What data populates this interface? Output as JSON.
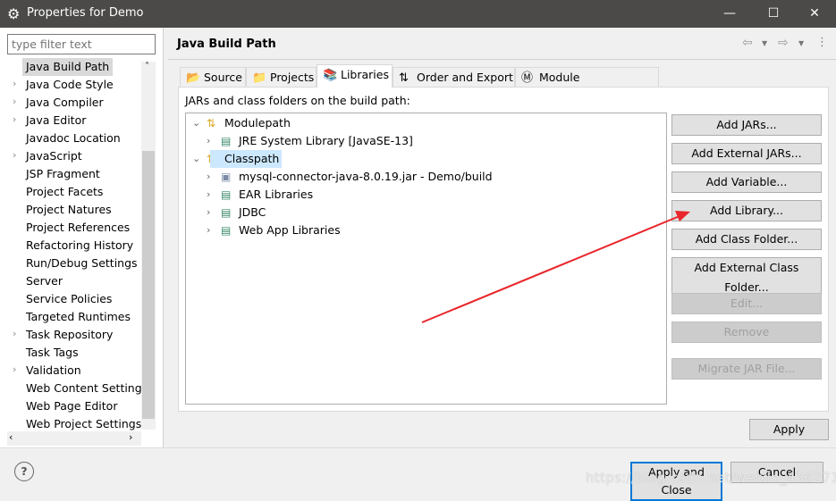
{
  "window": {
    "title": "Properties for Demo",
    "minimize": "—",
    "maximize": "☐",
    "close": "✕"
  },
  "filter": {
    "placeholder": "type filter text"
  },
  "nav": {
    "items": [
      {
        "label": "Java Build Path",
        "expandable": false,
        "selected": true
      },
      {
        "label": "Java Code Style",
        "expandable": true
      },
      {
        "label": "Java Compiler",
        "expandable": true
      },
      {
        "label": "Java Editor",
        "expandable": true
      },
      {
        "label": "Javadoc Location",
        "expandable": false
      },
      {
        "label": "JavaScript",
        "expandable": true
      },
      {
        "label": "JSP Fragment",
        "expandable": false
      },
      {
        "label": "Project Facets",
        "expandable": false
      },
      {
        "label": "Project Natures",
        "expandable": false
      },
      {
        "label": "Project References",
        "expandable": false
      },
      {
        "label": "Refactoring History",
        "expandable": false
      },
      {
        "label": "Run/Debug Settings",
        "expandable": false
      },
      {
        "label": "Server",
        "expandable": false
      },
      {
        "label": "Service Policies",
        "expandable": false
      },
      {
        "label": "Targeted Runtimes",
        "expandable": false
      },
      {
        "label": "Task Repository",
        "expandable": true
      },
      {
        "label": "Task Tags",
        "expandable": false
      },
      {
        "label": "Validation",
        "expandable": true
      },
      {
        "label": "Web Content Settings",
        "expandable": false
      },
      {
        "label": "Web Page Editor",
        "expandable": false
      },
      {
        "label": "Web Project Settings",
        "expandable": false
      }
    ]
  },
  "page": {
    "title": "Java Build Path",
    "description": "JARs and class folders on the build path:"
  },
  "tabs": [
    {
      "label": "Source",
      "icon": "📂"
    },
    {
      "label": "Projects",
      "icon": "📁"
    },
    {
      "label": "Libraries",
      "icon": "📚",
      "active": true
    },
    {
      "label": "Order and Export",
      "icon": "⇅"
    },
    {
      "label": "Module Dependencies",
      "icon": "Ⓜ"
    }
  ],
  "tree": [
    {
      "label": "Modulepath",
      "level": 0,
      "expanded": true,
      "icon": "path-icon"
    },
    {
      "label": "JRE System Library [JavaSE-13]",
      "level": 1,
      "icon": "library-icon"
    },
    {
      "label": "Classpath",
      "level": 0,
      "expanded": true,
      "icon": "path-icon",
      "highlighted": true
    },
    {
      "label": "mysql-connector-java-8.0.19.jar - Demo/build",
      "level": 1,
      "icon": "jar-icon"
    },
    {
      "label": "EAR Libraries",
      "level": 1,
      "icon": "library-icon"
    },
    {
      "label": "JDBC",
      "level": 1,
      "icon": "library-icon"
    },
    {
      "label": "Web App Libraries",
      "level": 1,
      "icon": "library-icon"
    }
  ],
  "buttons": {
    "add_jars": "Add JARs...",
    "add_external_jars": "Add External JARs...",
    "add_variable": "Add Variable...",
    "add_library": "Add Library...",
    "add_class_folder": "Add Class Folder...",
    "add_external_class_folder": "Add External Class Folder...",
    "edit": "Edit...",
    "remove": "Remove",
    "migrate": "Migrate JAR File...",
    "apply": "Apply",
    "apply_close": "Apply and Close",
    "cancel": "Cancel",
    "help": "?"
  },
  "watermark": "https://blog.csdn.net/weixin_43627118",
  "colors": {
    "annotation_arrow": "#e8262b",
    "selection": "#cce8ff",
    "focus": "#0078d7"
  }
}
